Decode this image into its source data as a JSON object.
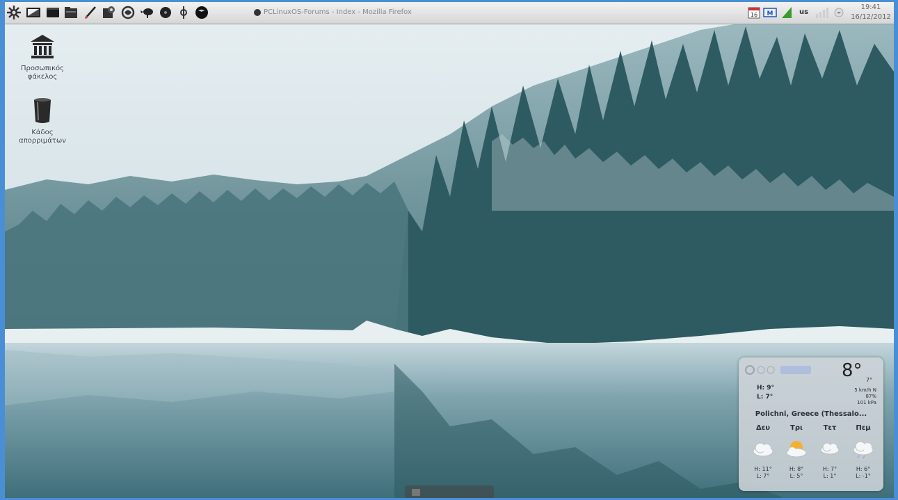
{
  "panel": {
    "launchers": [
      {
        "name": "kde-menu-icon"
      },
      {
        "name": "desktop-icon"
      },
      {
        "name": "terminal-icon"
      },
      {
        "name": "file-manager-icon"
      },
      {
        "name": "text-editor-icon"
      },
      {
        "name": "settings-icon"
      },
      {
        "name": "globe-icon"
      },
      {
        "name": "bird-icon"
      },
      {
        "name": "media-player-icon"
      },
      {
        "name": "disk-icon"
      },
      {
        "name": "firefox-icon"
      }
    ],
    "active_window_title": "PCLinuxOS-Forums - Index - Mozilla Firefox",
    "keyboard_layout": "us",
    "clock_time": "19:41",
    "clock_date": "16/12/2012"
  },
  "desktop": {
    "icons": [
      {
        "label_line1": "Προσωπικός",
        "label_line2": "φάκελος",
        "icon": "home-folder-icon"
      },
      {
        "label_line1": "Κάδος",
        "label_line2": "απορριμάτων",
        "icon": "trash-icon"
      }
    ]
  },
  "weather": {
    "temp": "8°",
    "temp_sub": "7°",
    "today_high": "H: 9°",
    "today_low": "L: 7°",
    "wind": "5 km/h N",
    "humidity": "87%",
    "pressure": "101 kPa",
    "location": "Polichni, Greece (Thessalo...",
    "forecast": [
      {
        "day": "Δευ",
        "high": "H: 11°",
        "low": "L: 7°",
        "icon": "cloud-icon"
      },
      {
        "day": "Τρι",
        "high": "H: 8°",
        "low": "L: 5°",
        "icon": "sun-cloud-icon"
      },
      {
        "day": "Τετ",
        "high": "H: 7°",
        "low": "L: 1°",
        "icon": "cloud-icon"
      },
      {
        "day": "Πεμ",
        "high": "H: 6°",
        "low": "L: -1°",
        "icon": "rain-cloud-icon"
      }
    ]
  },
  "colors": {
    "frame": "#4a8fd6",
    "sky": "#dfe8ec",
    "forest": "#25494f",
    "water": "#6f9aa6"
  }
}
